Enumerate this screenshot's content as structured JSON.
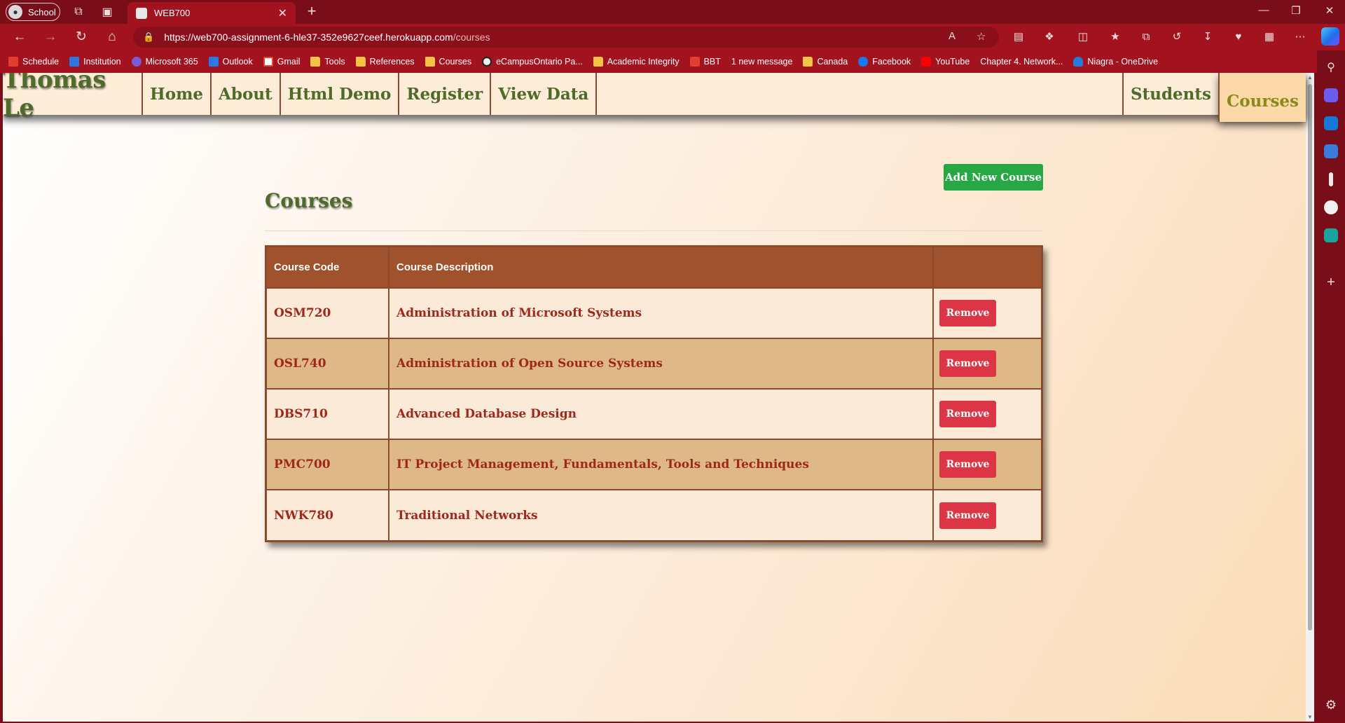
{
  "browser": {
    "profile_label": "School",
    "tab_title": "WEB700",
    "url_host": "https://web700-assignment-6-hle37-352e9627ceef.herokuapp.com",
    "url_path": "/courses"
  },
  "bookmarks": [
    {
      "label": "Schedule",
      "icon": "red"
    },
    {
      "label": "Institution",
      "icon": "blue"
    },
    {
      "label": "Microsoft 365",
      "icon": "purple"
    },
    {
      "label": "Outlook",
      "icon": "blue"
    },
    {
      "label": "Gmail",
      "icon": "gmail"
    },
    {
      "label": "Tools",
      "icon": "folder"
    },
    {
      "label": "References",
      "icon": "folder"
    },
    {
      "label": "Courses",
      "icon": "folder"
    },
    {
      "label": "eCampusOntario Pa...",
      "icon": "circle"
    },
    {
      "label": "Academic Integrity",
      "icon": "folder"
    },
    {
      "label": "BBT",
      "icon": "red"
    },
    {
      "label": "1 new message",
      "icon": "none"
    },
    {
      "label": "Canada",
      "icon": "folder"
    },
    {
      "label": "Facebook",
      "icon": "fb"
    },
    {
      "label": "YouTube",
      "icon": "yt"
    },
    {
      "label": "Chapter 4. Network...",
      "icon": "none"
    },
    {
      "label": "Niagra - OneDrive",
      "icon": "od"
    }
  ],
  "site": {
    "brand": "Thomas Le",
    "nav_left": [
      "Home",
      "About",
      "Html Demo",
      "Register",
      "View Data"
    ],
    "nav_right": [
      "Students",
      "Courses"
    ],
    "active": "Courses"
  },
  "page": {
    "title": "Courses",
    "add_button": "Add New Course",
    "columns": [
      "Course Code",
      "Course Description",
      ""
    ],
    "remove_label": "Remove",
    "rows": [
      {
        "code": "OSM720",
        "description": "Administration of Microsoft Systems"
      },
      {
        "code": "OSL740",
        "description": "Administration of Open Source Systems"
      },
      {
        "code": "DBS710",
        "description": "Advanced Database Design"
      },
      {
        "code": "PMC700",
        "description": "IT Project Management, Fundamentals, Tools and Techniques"
      },
      {
        "code": "NWK780",
        "description": "Traditional Networks"
      }
    ]
  }
}
